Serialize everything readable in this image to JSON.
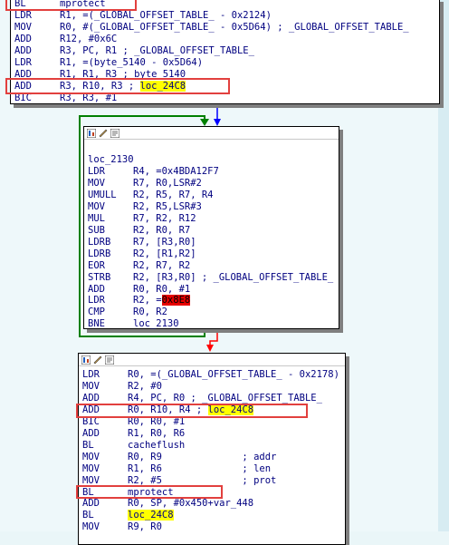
{
  "top_block": {
    "lines": [
      {
        "mn": "BL",
        "op": "mprotect",
        "extra": ""
      },
      {
        "mn": "LDR",
        "op": "R1, =(_GLOBAL_OFFSET_TABLE_ - 0x2124)",
        "extra": ""
      },
      {
        "mn": "MOV",
        "op": "R0, #(_GLOBAL_OFFSET_TABLE_ - 0x5D64) ; _GLOBAL_OFFSET_TABLE_",
        "extra": ""
      },
      {
        "mn": "ADD",
        "op": "R12, #0x6C",
        "extra": ""
      },
      {
        "mn": "ADD",
        "op": "R3, PC, R1 ; _GLOBAL_OFFSET_TABLE_",
        "extra": ""
      },
      {
        "mn": "LDR",
        "op": "R1, =(byte_5140 - 0x5D64)",
        "extra": ""
      },
      {
        "mn": "ADD",
        "op": "R1, R1, R3 ; byte_5140",
        "extra": ""
      },
      {
        "mn": "ADD",
        "op": "R3, R10, R3 ; ",
        "extra": "loc_24C8"
      },
      {
        "mn": "BIC",
        "op": "R3, R3, #1",
        "extra": ""
      }
    ]
  },
  "loop_block": {
    "label": "loc_2130",
    "lines": [
      {
        "mn": "LDR",
        "op": "R4, =0x4BDA12F7",
        "extra": ""
      },
      {
        "mn": "MOV",
        "op": "R7, R0,LSR#2",
        "extra": ""
      },
      {
        "mn": "UMULL",
        "op": "R2, R5, R7, R4",
        "extra": ""
      },
      {
        "mn": "MOV",
        "op": "R2, R5,LSR#3",
        "extra": ""
      },
      {
        "mn": "MUL",
        "op": "R7, R2, R12",
        "extra": ""
      },
      {
        "mn": "SUB",
        "op": "R2, R0, R7",
        "extra": ""
      },
      {
        "mn": "LDRB",
        "op": "R7, [R3,R0]",
        "extra": ""
      },
      {
        "mn": "LDRB",
        "op": "R2, [R1,R2]",
        "extra": ""
      },
      {
        "mn": "EOR",
        "op": "R2, R7, R2",
        "extra": ""
      },
      {
        "mn": "STRB",
        "op": "R2, [R3,R0] ; _GLOBAL_OFFSET_TABLE_",
        "extra": ""
      },
      {
        "mn": "ADD",
        "op": "R0, R0, #1",
        "extra": ""
      },
      {
        "mn": "LDR",
        "op": "R2, =",
        "extra": "0x8E8"
      },
      {
        "mn": "CMP",
        "op": "R0, R2",
        "extra": ""
      },
      {
        "mn": "BNE",
        "op": "loc_2130",
        "extra": ""
      }
    ]
  },
  "bottom_block": {
    "lines": [
      {
        "mn": "LDR",
        "op": "R0, =(_GLOBAL_OFFSET_TABLE_ - 0x2178)",
        "extra": ""
      },
      {
        "mn": "MOV",
        "op": "R2, #0",
        "extra": ""
      },
      {
        "mn": "ADD",
        "op": "R4, PC, R0 ; _GLOBAL_OFFSET_TABLE_",
        "extra": ""
      },
      {
        "mn": "ADD",
        "op": "R0, R10, R4 ; ",
        "extra": "loc_24C8"
      },
      {
        "mn": "BIC",
        "op": "R0, R0, #1",
        "extra": ""
      },
      {
        "mn": "ADD",
        "op": "R1, R0, R6",
        "extra": ""
      },
      {
        "mn": "BL",
        "op": "cacheflush",
        "extra": ""
      },
      {
        "mn": "MOV",
        "op": "R0, R9              ; addr",
        "extra": ""
      },
      {
        "mn": "MOV",
        "op": "R1, R6              ; len",
        "extra": ""
      },
      {
        "mn": "MOV",
        "op": "R2, #5              ; prot",
        "extra": ""
      },
      {
        "mn": "BL",
        "op": "mprotect",
        "extra": ""
      },
      {
        "mn": "ADD",
        "op": "R0, SP, #0x450+var_448",
        "extra": ""
      },
      {
        "mn": "BL",
        "op": "",
        "extra": "loc_24C8"
      },
      {
        "mn": "MOV",
        "op": "R9, R0",
        "extra": ""
      }
    ]
  },
  "colors": {
    "text": "#000080",
    "highlight_yellow": "#ffff00",
    "highlight_red": "#e60000",
    "annotation_box": "#e2403e",
    "edge_loop": "#008000",
    "edge_false": "#0000ff",
    "edge_exit": "#ff0000"
  },
  "icons": [
    "graph-view-icon",
    "graph-rename-icon",
    "graph-text-view-icon"
  ]
}
